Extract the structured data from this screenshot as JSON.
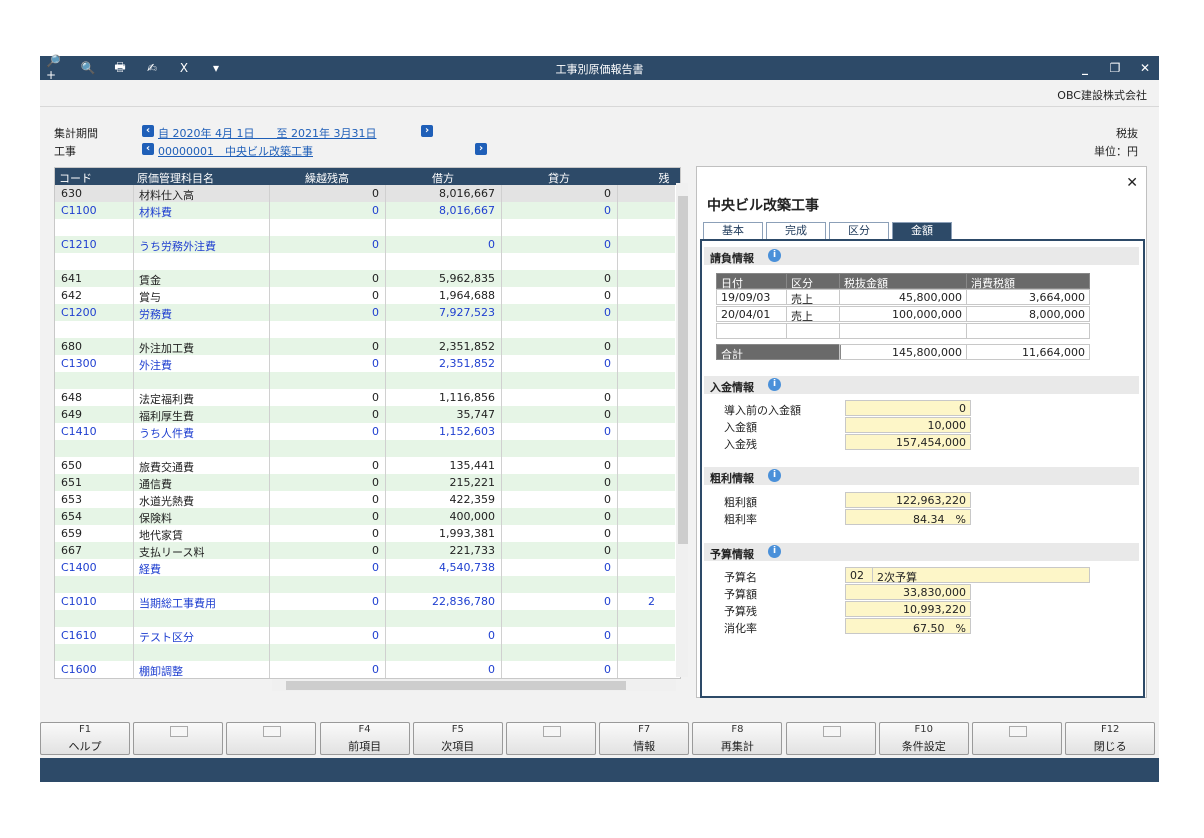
{
  "window": {
    "title": "工事別原価報告書",
    "company": "OBC建設株式会社"
  },
  "toolbar": {
    "icons": [
      "magnifier-plus-icon",
      "magnifier-icon",
      "printer-icon",
      "signature-icon",
      "excel-check-icon",
      "dropdown-arrow-icon"
    ],
    "icon_glyphs": [
      "🔎+",
      "🔍",
      "🖶",
      "✍",
      "X",
      "▾"
    ]
  },
  "window_controls": {
    "minimize": "_",
    "restore": "❐",
    "close": "✕"
  },
  "filters": {
    "period_label": "集計期間",
    "period_value": "自 2020年 4月 1日　　至 2021年 3月31日",
    "project_label": "工事",
    "project_value": "00000001　中央ビル改築工事",
    "tax_label": "税抜",
    "unit_label": "単位：円"
  },
  "grid": {
    "columns": [
      "コード",
      "原価管理科目名",
      "繰越残高",
      "借方",
      "貸方",
      "残"
    ],
    "rows": [
      {
        "code": "630",
        "name": "材料仕入高",
        "carry": "0",
        "debit": "8,016,667",
        "credit": "0",
        "rest": "",
        "type": "detail",
        "sel": true
      },
      {
        "code": "C1100",
        "name": "材料費",
        "carry": "0",
        "debit": "8,016,667",
        "credit": "0",
        "rest": "",
        "type": "sum"
      },
      {
        "code": "",
        "name": "",
        "carry": "",
        "debit": "",
        "credit": "",
        "rest": "",
        "type": "blank"
      },
      {
        "code": "C1210",
        "name": "うち労務外注費",
        "carry": "0",
        "debit": "0",
        "credit": "0",
        "rest": "",
        "type": "sum"
      },
      {
        "code": "",
        "name": "",
        "carry": "",
        "debit": "",
        "credit": "",
        "rest": "",
        "type": "blank"
      },
      {
        "code": "641",
        "name": "賃金",
        "carry": "0",
        "debit": "5,962,835",
        "credit": "0",
        "rest": "",
        "type": "detail"
      },
      {
        "code": "642",
        "name": "賞与",
        "carry": "0",
        "debit": "1,964,688",
        "credit": "0",
        "rest": "",
        "type": "detail"
      },
      {
        "code": "C1200",
        "name": "労務費",
        "carry": "0",
        "debit": "7,927,523",
        "credit": "0",
        "rest": "",
        "type": "sum"
      },
      {
        "code": "",
        "name": "",
        "carry": "",
        "debit": "",
        "credit": "",
        "rest": "",
        "type": "blank"
      },
      {
        "code": "680",
        "name": "外注加工費",
        "carry": "0",
        "debit": "2,351,852",
        "credit": "0",
        "rest": "",
        "type": "detail"
      },
      {
        "code": "C1300",
        "name": "外注費",
        "carry": "0",
        "debit": "2,351,852",
        "credit": "0",
        "rest": "",
        "type": "sum"
      },
      {
        "code": "",
        "name": "",
        "carry": "",
        "debit": "",
        "credit": "",
        "rest": "",
        "type": "blank"
      },
      {
        "code": "648",
        "name": "法定福利費",
        "carry": "0",
        "debit": "1,116,856",
        "credit": "0",
        "rest": "",
        "type": "detail"
      },
      {
        "code": "649",
        "name": "福利厚生費",
        "carry": "0",
        "debit": "35,747",
        "credit": "0",
        "rest": "",
        "type": "detail"
      },
      {
        "code": "C1410",
        "name": "うち人件費",
        "carry": "0",
        "debit": "1,152,603",
        "credit": "0",
        "rest": "",
        "type": "sum"
      },
      {
        "code": "",
        "name": "",
        "carry": "",
        "debit": "",
        "credit": "",
        "rest": "",
        "type": "blank"
      },
      {
        "code": "650",
        "name": "旅費交通費",
        "carry": "0",
        "debit": "135,441",
        "credit": "0",
        "rest": "",
        "type": "detail"
      },
      {
        "code": "651",
        "name": "通信費",
        "carry": "0",
        "debit": "215,221",
        "credit": "0",
        "rest": "",
        "type": "detail"
      },
      {
        "code": "653",
        "name": "水道光熱費",
        "carry": "0",
        "debit": "422,359",
        "credit": "0",
        "rest": "",
        "type": "detail"
      },
      {
        "code": "654",
        "name": "保険料",
        "carry": "0",
        "debit": "400,000",
        "credit": "0",
        "rest": "",
        "type": "detail"
      },
      {
        "code": "659",
        "name": "地代家賃",
        "carry": "0",
        "debit": "1,993,381",
        "credit": "0",
        "rest": "",
        "type": "detail"
      },
      {
        "code": "667",
        "name": "支払リース料",
        "carry": "0",
        "debit": "221,733",
        "credit": "0",
        "rest": "",
        "type": "detail"
      },
      {
        "code": "C1400",
        "name": "経費",
        "carry": "0",
        "debit": "4,540,738",
        "credit": "0",
        "rest": "",
        "type": "sum"
      },
      {
        "code": "",
        "name": "",
        "carry": "",
        "debit": "",
        "credit": "",
        "rest": "",
        "type": "blank"
      },
      {
        "code": "C1010",
        "name": "当期総工事費用",
        "carry": "0",
        "debit": "22,836,780",
        "credit": "0",
        "rest": "2",
        "type": "sum"
      },
      {
        "code": "",
        "name": "",
        "carry": "",
        "debit": "",
        "credit": "",
        "rest": "",
        "type": "blank"
      },
      {
        "code": "C1610",
        "name": "テスト区分",
        "carry": "0",
        "debit": "0",
        "credit": "0",
        "rest": "",
        "type": "sum"
      },
      {
        "code": "",
        "name": "",
        "carry": "",
        "debit": "",
        "credit": "",
        "rest": "",
        "type": "blank"
      },
      {
        "code": "C1600",
        "name": "棚卸調整",
        "carry": "0",
        "debit": "0",
        "credit": "0",
        "rest": "",
        "type": "sum"
      }
    ]
  },
  "panel": {
    "title": "中央ビル改築工事",
    "tabs": [
      "基本",
      "完成",
      "区分",
      "金額"
    ],
    "active_tab": 3,
    "invoice": {
      "header": "請負情報",
      "columns": [
        "日付",
        "区分",
        "税抜金額",
        "消費税額"
      ],
      "rows": [
        {
          "date": "19/09/03",
          "kind": "売上",
          "amount": "45,800,000",
          "tax": "3,664,000"
        },
        {
          "date": "20/04/01",
          "kind": "売上",
          "amount": "100,000,000",
          "tax": "8,000,000"
        }
      ],
      "total_label": "合計",
      "total_amount": "145,800,000",
      "total_tax": "11,664,000"
    },
    "receipt": {
      "header": "入金情報",
      "items": [
        {
          "label": "導入前の入金額",
          "value": "0"
        },
        {
          "label": "入金額",
          "value": "10,000"
        },
        {
          "label": "入金残",
          "value": "157,454,000"
        }
      ]
    },
    "profit": {
      "header": "粗利情報",
      "items": [
        {
          "label": "粗利額",
          "value": "122,963,220"
        },
        {
          "label": "粗利率",
          "value": "84.34　%"
        }
      ]
    },
    "budget": {
      "header": "予算情報",
      "name_label": "予算名",
      "name_code": "02",
      "name_value": "2次予算",
      "items": [
        {
          "label": "予算額",
          "value": "33,830,000"
        },
        {
          "label": "予算残",
          "value": "10,993,220"
        },
        {
          "label": "消化率",
          "value": "67.50　%"
        }
      ]
    }
  },
  "fkeys": [
    {
      "key": "F1",
      "label": "ヘルプ"
    },
    {
      "key": "",
      "label": ""
    },
    {
      "key": "",
      "label": ""
    },
    {
      "key": "F4",
      "label": "前項目"
    },
    {
      "key": "F5",
      "label": "次項目"
    },
    {
      "key": "",
      "label": ""
    },
    {
      "key": "F7",
      "label": "情報"
    },
    {
      "key": "F8",
      "label": "再集計"
    },
    {
      "key": "",
      "label": ""
    },
    {
      "key": "F10",
      "label": "条件設定"
    },
    {
      "key": "",
      "label": ""
    },
    {
      "key": "F12",
      "label": "閉じる"
    }
  ]
}
